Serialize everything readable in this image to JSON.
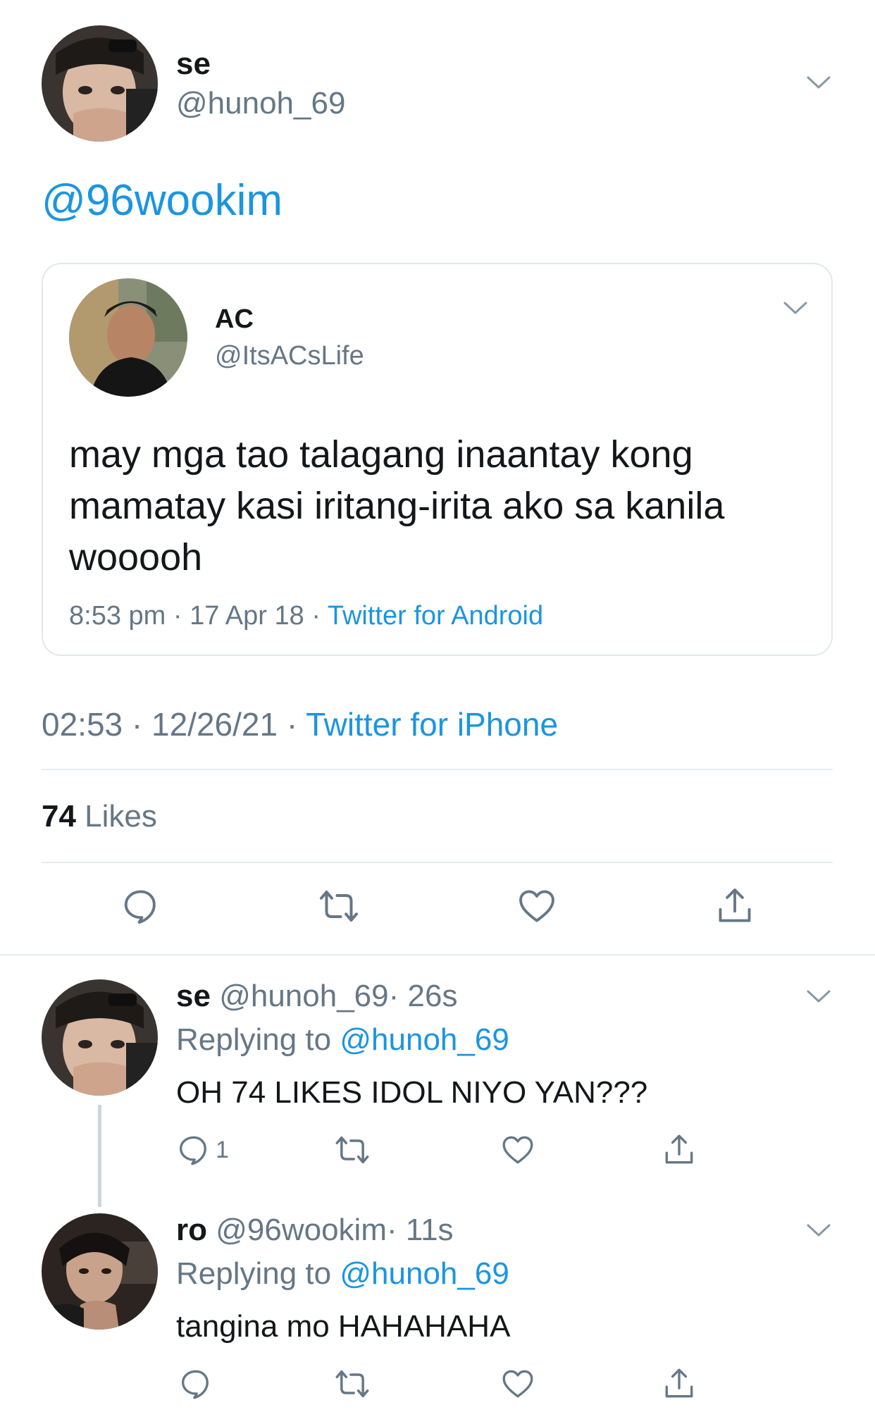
{
  "tweet": {
    "author_name": "se",
    "author_handle": "@hunoh_69",
    "text_mention": "@96wookim",
    "timestamp": "02:53 · 12/26/21 · ",
    "source": "Twitter for iPhone",
    "likes_count": "74",
    "likes_label": " Likes"
  },
  "quoted": {
    "author_name": "AC",
    "author_handle": "@ItsACsLife",
    "text": "may mga tao talagang inaantay kong mamatay kasi iritang-irita ako sa kanila wooooh",
    "timestamp": "8:53 pm · 17 Apr 18 · ",
    "source": "Twitter for Android"
  },
  "replies": [
    {
      "author_name": "se",
      "author_handle": "@hunoh_69",
      "time": "· 26s",
      "replying_label": "Replying to ",
      "replying_to": "@hunoh_69",
      "text": "OH 74 LIKES IDOL NIYO YAN???",
      "reply_count": "1"
    },
    {
      "author_name": "ro",
      "author_handle": "@96wookim",
      "time": "· 11s",
      "replying_label": "Replying to ",
      "replying_to": "@hunoh_69",
      "text": "tangina mo HAHAHAHA",
      "reply_count": ""
    }
  ],
  "icons": {
    "reply": "reply-icon",
    "retweet": "retweet-icon",
    "like": "heart-icon",
    "share": "share-icon",
    "more": "chevron-down-icon"
  },
  "colors": {
    "link": "#1b95e0",
    "secondary_text": "#657786",
    "primary_text": "#14171a",
    "divider": "#e6ecf0"
  }
}
